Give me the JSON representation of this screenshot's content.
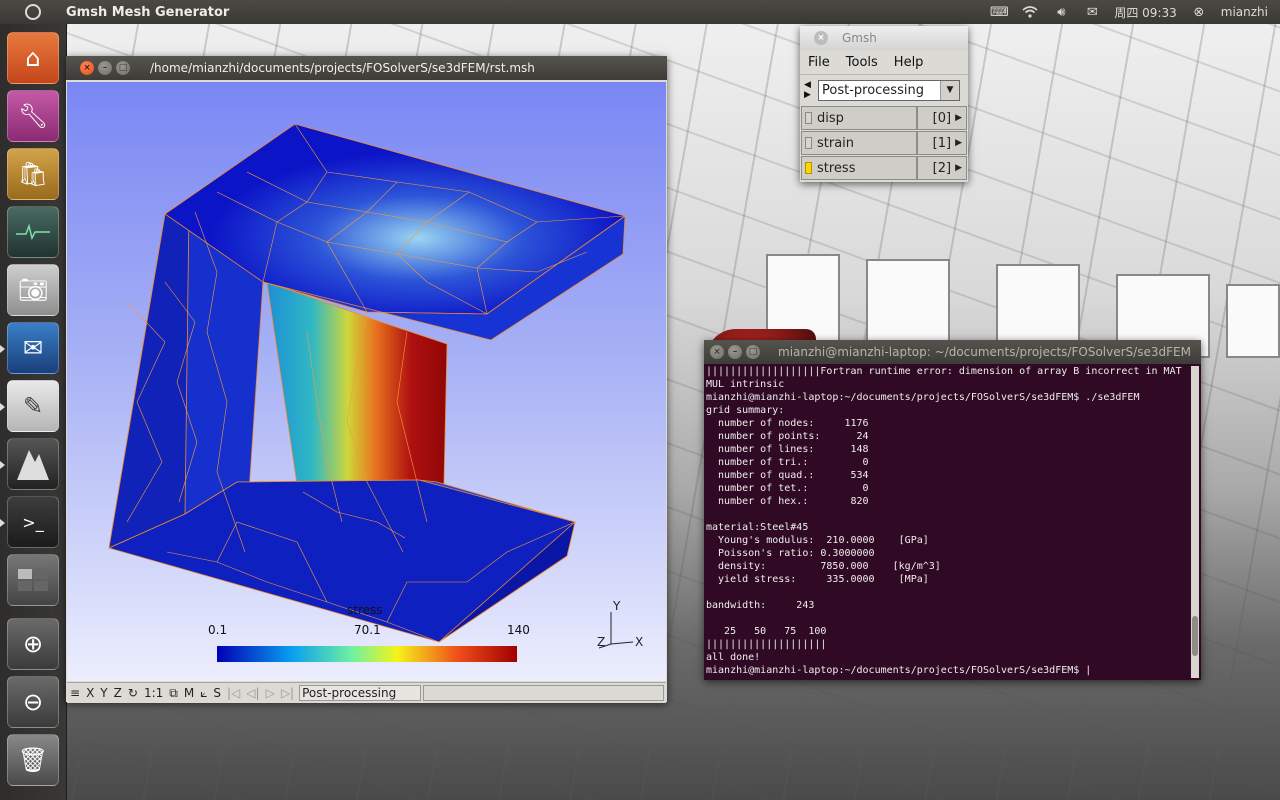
{
  "top_panel": {
    "app_title": "Gmsh Mesh Generator",
    "clock": "周四 09:33",
    "user": "mianzhi",
    "indicators": [
      "keyboard-icon",
      "wifi-icon",
      "volume-icon",
      "mail-icon",
      "user-icon"
    ]
  },
  "launcher": {
    "items": [
      "home-folder-icon",
      "system-settings-icon",
      "ubuntu-software-center-icon",
      "system-monitor-icon",
      "camera-icon",
      "thunderbird-icon",
      "text-editor-icon",
      "gmsh-icon",
      "terminal-icon",
      "workspace-switcher-icon",
      "zoom-in-icon",
      "zoom-out-icon",
      "trash-icon"
    ]
  },
  "mesh_window": {
    "path": "/home/mianzhi/documents/projects/FOSolverS/se3dFEM/rst.msh",
    "colorbar": {
      "min": "0.1",
      "mid": "70.1",
      "max": "140",
      "label": "stress"
    },
    "axes": {
      "y": "Y",
      "z": "Z",
      "x": "X"
    },
    "statusbar": {
      "buttons": [
        "≡",
        "X",
        "Y",
        "Z",
        "↻",
        "1:1",
        "⧉",
        "M",
        "⟀",
        "S",
        "|◁",
        "◁|",
        "▷",
        "▷|"
      ],
      "status_text": "Post-processing"
    }
  },
  "gmsh_window": {
    "title": "Gmsh",
    "menu": [
      "File",
      "Tools",
      "Help"
    ],
    "module": "Post-processing",
    "views": [
      {
        "name": "disp",
        "index": "[0]",
        "visible": false
      },
      {
        "name": "strain",
        "index": "[1]",
        "visible": false
      },
      {
        "name": "stress",
        "index": "[2]",
        "visible": true
      }
    ]
  },
  "terminal": {
    "title": "mianzhi@mianzhi-laptop: ~/documents/projects/FOSolverS/se3dFEM",
    "lines": [
      "|||||||||||||||||||Fortran runtime error: dimension of array B incorrect in MAT",
      "MUL intrinsic",
      "mianzhi@mianzhi-laptop:~/documents/projects/FOSolverS/se3dFEM$ ./se3dFEM",
      "grid summary:",
      "  number of nodes:     1176",
      "  number of points:      24",
      "  number of lines:      148",
      "  number of tri.:         0",
      "  number of quad.:      534",
      "  number of tet.:         0",
      "  number of hex.:       820",
      "",
      "material:Steel#45",
      "  Young's modulus:  210.0000    [GPa]",
      "  Poisson's ratio: 0.3000000",
      "  density:         7850.000    [kg/m^3]",
      "  yield stress:     335.0000    [MPa]",
      "",
      "bandwidth:     243",
      "",
      "   25   50   75  100",
      "||||||||||||||||||||",
      "all done!",
      "mianzhi@mianzhi-laptop:~/documents/projects/FOSolverS/se3dFEM$ |"
    ]
  }
}
